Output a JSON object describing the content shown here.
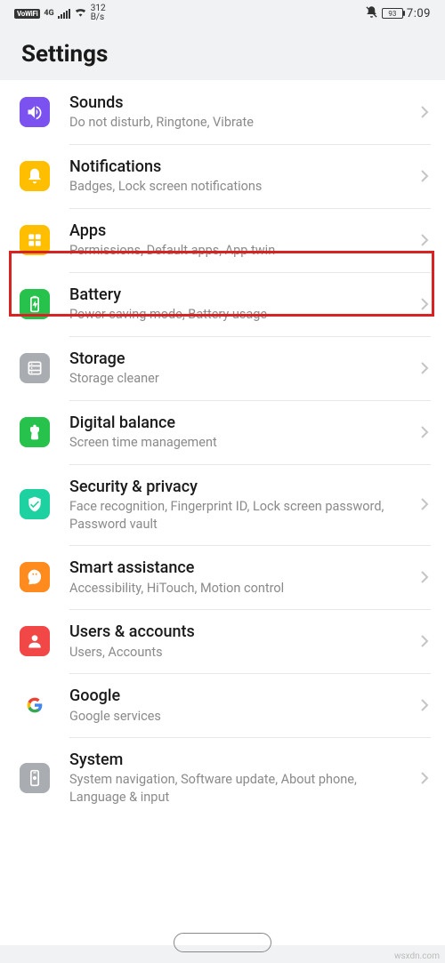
{
  "status": {
    "vowifi": "VoWiFi",
    "signal": "4G",
    "speed_top": "312",
    "speed_bottom": "B/s",
    "battery": "93",
    "time": "7:09"
  },
  "header": {
    "title": "Settings"
  },
  "items": [
    {
      "title": "Sounds",
      "subtitle": "Do not disturb, Ringtone, Vibrate",
      "icon": "sounds"
    },
    {
      "title": "Notifications",
      "subtitle": "Badges, Lock screen notifications",
      "icon": "notifications"
    },
    {
      "title": "Apps",
      "subtitle": "Permissions, Default apps, App twin",
      "icon": "apps"
    },
    {
      "title": "Battery",
      "subtitle": "Power saving mode, Battery usage",
      "icon": "battery"
    },
    {
      "title": "Storage",
      "subtitle": "Storage cleaner",
      "icon": "storage"
    },
    {
      "title": "Digital balance",
      "subtitle": "Screen time management",
      "icon": "digital"
    },
    {
      "title": "Security & privacy",
      "subtitle": "Face recognition, Fingerprint ID, Lock screen password, Password vault",
      "icon": "security"
    },
    {
      "title": "Smart assistance",
      "subtitle": "Accessibility, HiTouch, Motion control",
      "icon": "smart"
    },
    {
      "title": "Users & accounts",
      "subtitle": "Users, Accounts",
      "icon": "users"
    },
    {
      "title": "Google",
      "subtitle": "Google services",
      "icon": "google"
    },
    {
      "title": "System",
      "subtitle": "System navigation, Software update, About phone, Language & input",
      "icon": "system"
    }
  ],
  "watermark": "wsxdn.com"
}
